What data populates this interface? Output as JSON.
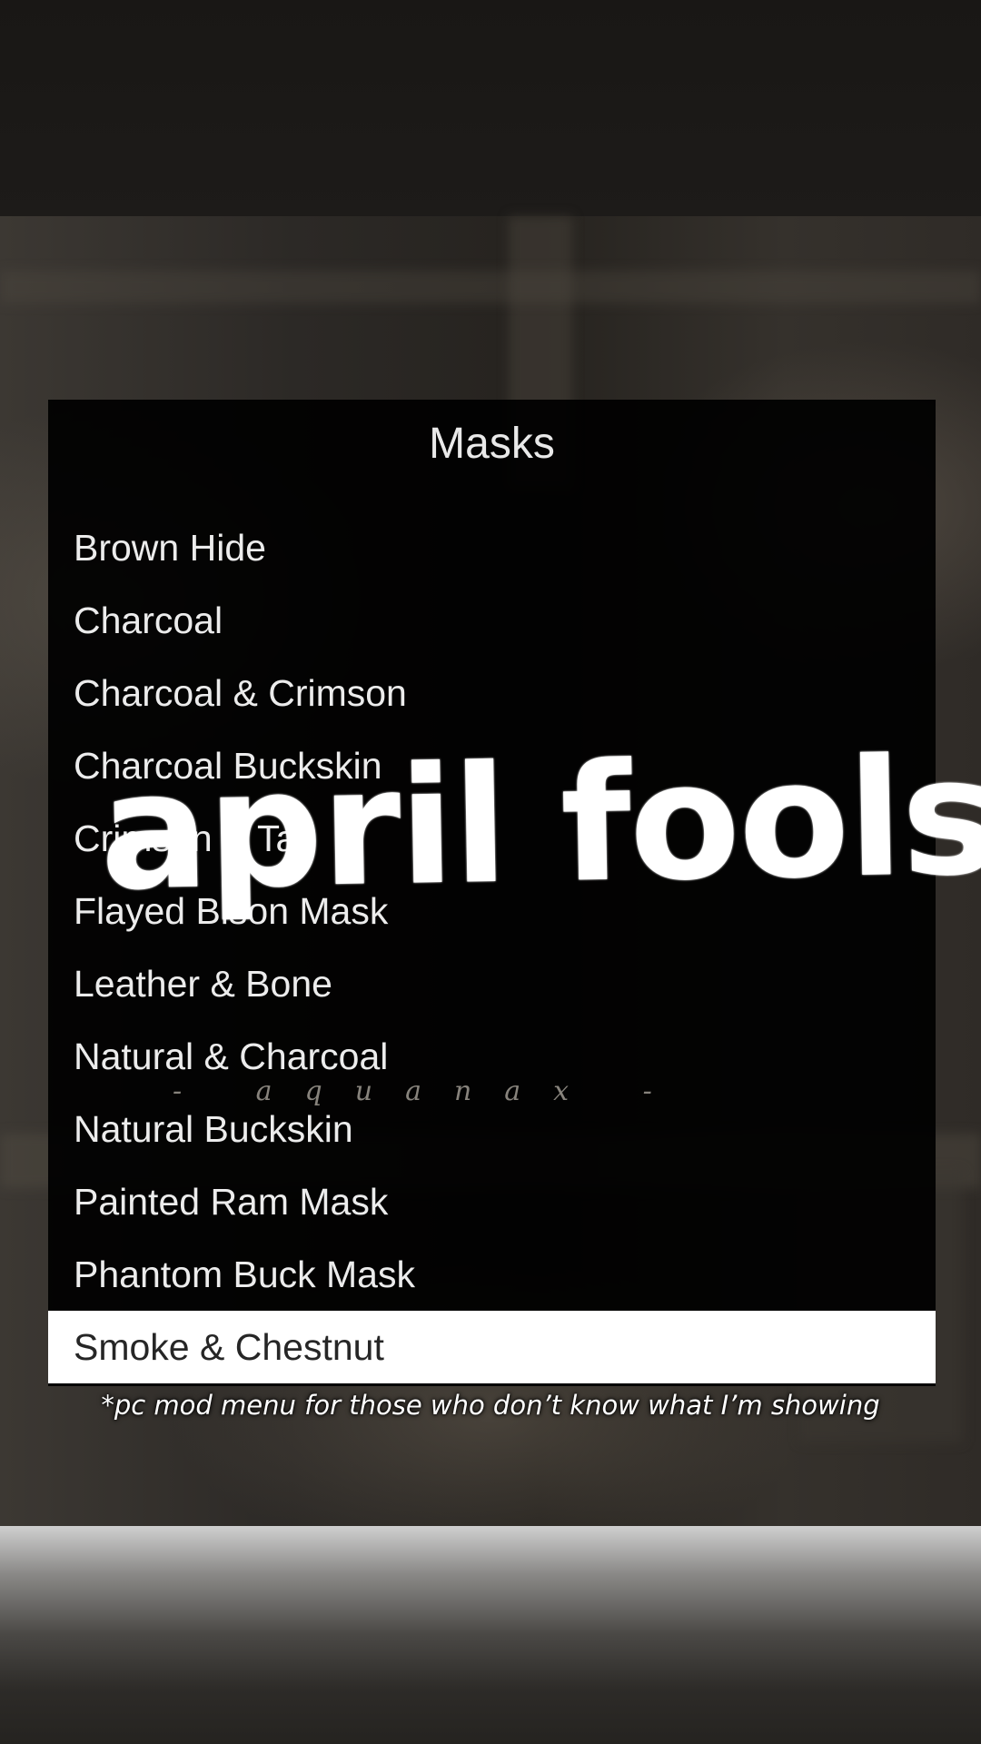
{
  "menu": {
    "title": "Masks",
    "items": [
      {
        "label": "Brown Hide",
        "selected": false
      },
      {
        "label": "Charcoal",
        "selected": false
      },
      {
        "label": "Charcoal & Crimson",
        "selected": false
      },
      {
        "label": "Charcoal Buckskin",
        "selected": false
      },
      {
        "label": "Crimson & Tan",
        "selected": false
      },
      {
        "label": "Flayed Bison Mask",
        "selected": false
      },
      {
        "label": "Leather & Bone",
        "selected": false
      },
      {
        "label": "Natural & Charcoal",
        "selected": false
      },
      {
        "label": "Natural Buckskin",
        "selected": false
      },
      {
        "label": "Painted Ram Mask",
        "selected": false
      },
      {
        "label": "Phantom Buck Mask",
        "selected": false
      },
      {
        "label": "Smoke & Chestnut",
        "selected": true
      }
    ]
  },
  "overlay": {
    "title": "april fools.",
    "watermark": "- aquanax -",
    "caption": "*pc mod menu for those who don’t know what I’m showing"
  }
}
